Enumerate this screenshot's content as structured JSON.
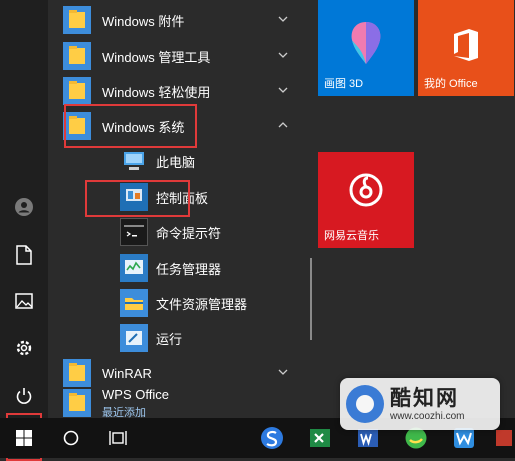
{
  "app_list": {
    "items": [
      {
        "label": "Windows 附件",
        "chevron": "down"
      },
      {
        "label": "Windows 管理工具",
        "chevron": "down"
      },
      {
        "label": "Windows 轻松使用",
        "chevron": "down"
      },
      {
        "label": "Windows 系统",
        "chevron": "up"
      },
      {
        "label": "此电脑"
      },
      {
        "label": "控制面板"
      },
      {
        "label": "命令提示符"
      },
      {
        "label": "任务管理器"
      },
      {
        "label": "文件资源管理器"
      },
      {
        "label": "运行"
      },
      {
        "label": "WinRAR",
        "chevron": "down"
      },
      {
        "label": "WPS Office",
        "badge": "最近添加"
      }
    ]
  },
  "tiles": [
    {
      "label": "画图 3D",
      "color": "#0078d7"
    },
    {
      "label": "我的 Office",
      "color": "#e8501a"
    },
    {
      "label": "网易云音乐",
      "color": "#d71921"
    }
  ],
  "rail_icons": [
    "user-icon",
    "document-icon",
    "pictures-icon",
    "settings-icon",
    "power-icon",
    "windows-start-icon"
  ],
  "taskbar_icons": [
    "cortana-icon",
    "task-view-icon",
    "sogou-icon",
    "excel-icon",
    "word-icon",
    "360-icon",
    "wps-icon",
    "app-icon"
  ],
  "watermark": {
    "title": "酷知网",
    "url": "www.coozhi.com"
  },
  "colors": {
    "highlight_border": "#e03a3a",
    "accent": "#0078d7"
  }
}
